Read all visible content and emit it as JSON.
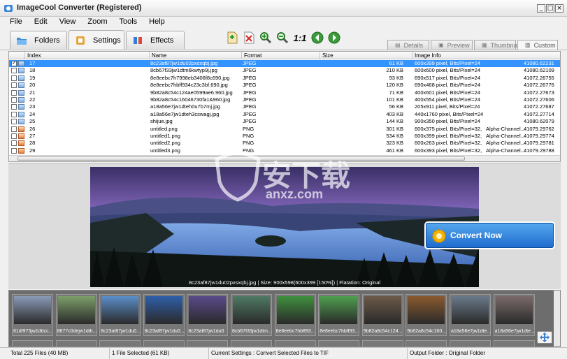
{
  "window": {
    "title": "ImageCool Converter  (Registered)"
  },
  "menu": [
    "File",
    "Edit",
    "View",
    "Zoom",
    "Tools",
    "Help"
  ],
  "main_tabs": [
    {
      "label": "Folders",
      "icon": "folders-icon"
    },
    {
      "label": "Settings",
      "icon": "settings-icon"
    },
    {
      "label": "Effects",
      "icon": "effects-icon"
    }
  ],
  "toolbar": {
    "actual_size_label": "1:1",
    "tools": [
      "add-files-icon",
      "remove-icon",
      "zoom-in-icon",
      "zoom-out-icon",
      "actual-size-icon",
      "previous-icon",
      "next-icon"
    ]
  },
  "view_tabs": [
    {
      "label": "Details"
    },
    {
      "label": "Preview"
    },
    {
      "label": "Thumbnails"
    },
    {
      "label": "Custom"
    }
  ],
  "table": {
    "columns": [
      "Index",
      "Name",
      "Format",
      "Size",
      "Image Info"
    ],
    "rows": [
      {
        "checked": true,
        "type": "jpg",
        "index": "17",
        "name": "8c23af87jw1du02pxsxqbj.jpg",
        "format": "JPEG",
        "size": "61 KB",
        "info": "600x399 pixel,    Bits/Pixel=24",
        "extra": "",
        "date": "41080.62231"
      },
      {
        "checked": false,
        "type": "jpg",
        "index": "18",
        "name": "8cb67f33jw1dtm6kwtyp9j.jpg",
        "format": "JPEG",
        "size": "210 KB",
        "info": "600x600 pixel,    Bits/Pixel=24",
        "extra": "",
        "date": "41080.62109"
      },
      {
        "checked": false,
        "type": "jpg",
        "index": "19",
        "name": "8e8eebc7h7998eb3406f8c690.jpg",
        "format": "JPEG",
        "size": "93 KB",
        "info": "690x517 pixel,    Bits/Pixel=24",
        "extra": "",
        "date": "41072.26755"
      },
      {
        "checked": false,
        "type": "jpg",
        "index": "20",
        "name": "8e8eebc7hbff934c23c3bf.690.jpg",
        "format": "JPEG",
        "size": "120 KB",
        "info": "690x468 pixel,    Bits/Pixel=24",
        "extra": "",
        "date": "41072.26776"
      },
      {
        "checked": false,
        "type": "jpg",
        "index": "21",
        "name": "9b82a8c54c124ae0599ae6.960.jpg",
        "format": "JPEG",
        "size": "71 KB",
        "info": "400x601 pixel,    Bits/Pixel=24",
        "extra": "",
        "date": "41072.27673"
      },
      {
        "checked": false,
        "type": "jpg",
        "index": "22",
        "name": "9b82a8c54c16046730fa1&960.jpg",
        "format": "JPEG",
        "size": "101 KB",
        "info": "400x554 pixel,    Bits/Pixel=24",
        "extra": "",
        "date": "41072.27606"
      },
      {
        "checked": false,
        "type": "jpg",
        "index": "23",
        "name": "a18a56e7jw1dteh0u7b7mj.jpg",
        "format": "JPEG",
        "size": "56 KB",
        "info": "205x911 pixel,    Bits/Pixel=24",
        "extra": "",
        "date": "41072.27687"
      },
      {
        "checked": false,
        "type": "jpg",
        "index": "24",
        "name": "a18a56e7jw1dteh3cswagj.jpg",
        "format": "JPEG",
        "size": "403 KB",
        "info": "440x1760 pixel,    Bits/Pixel=24",
        "extra": "",
        "date": "41072.27714"
      },
      {
        "checked": false,
        "type": "jpg",
        "index": "25",
        "name": "shijue.jpg",
        "format": "JPEG",
        "size": "144 KB",
        "info": "900x350 pixel,    Bits/Pixel=24",
        "extra": "",
        "date": "41080.62079"
      },
      {
        "checked": false,
        "type": "png",
        "index": "26",
        "name": "untitled.png",
        "format": "PNG",
        "size": "301 KB",
        "info": "600x375 pixel,    Bits/Pixel=32,",
        "extra": "Alpha-Channel...",
        "date": "41079.29762"
      },
      {
        "checked": false,
        "type": "png",
        "index": "27",
        "name": "untitled1.png",
        "format": "PNG",
        "size": "534 KB",
        "info": "600x399 pixel,    Bits/Pixel=32,",
        "extra": "Alpha-Channel...",
        "date": "41079.29774"
      },
      {
        "checked": false,
        "type": "png",
        "index": "28",
        "name": "untitled2.png",
        "format": "PNG",
        "size": "323 KB",
        "info": "600x263 pixel,    Bits/Pixel=32,",
        "extra": "Alpha-Channel...",
        "date": "41079.29781"
      },
      {
        "checked": false,
        "type": "png",
        "index": "29",
        "name": "untitled3.png",
        "format": "PNG",
        "size": "461 KB",
        "info": "600x393 pixel,    Bits/Pixel=32,",
        "extra": "Alpha-Channel...",
        "date": "41079.29788"
      }
    ]
  },
  "preview": {
    "caption": "8c23af87jw1du02pxsxqbj.jpg  |  Size: 900x598(600x399 [150%])  |  Flatation: Original"
  },
  "convert_button": {
    "label": "Convert Now"
  },
  "thumbnails": [
    "81df973jw1dttcc...",
    "8677c0dejw1dth...",
    "8c23af87jw1du0...",
    "8c23af87jw1du0...",
    "8c23af87jw1du0",
    "8cb67f33jw1dtm...",
    "8e8eebc7hbff93...",
    "8e8eebc7hbff93...",
    "9b82a8c54c124...",
    "9b82a8c54c160...",
    "a18a56e7jw1dte...",
    "a18a56e7jw1dte..."
  ],
  "watermark": {
    "text_cn": "安下载",
    "text_en": "anxz.com"
  },
  "status": {
    "total": "Total 225 Files (40 MB)",
    "selected": "1 File Selected (61 KB)",
    "settings": "Current Settings : Convert Selected Files to TIF",
    "output": "Output Folder : Original Folder"
  }
}
